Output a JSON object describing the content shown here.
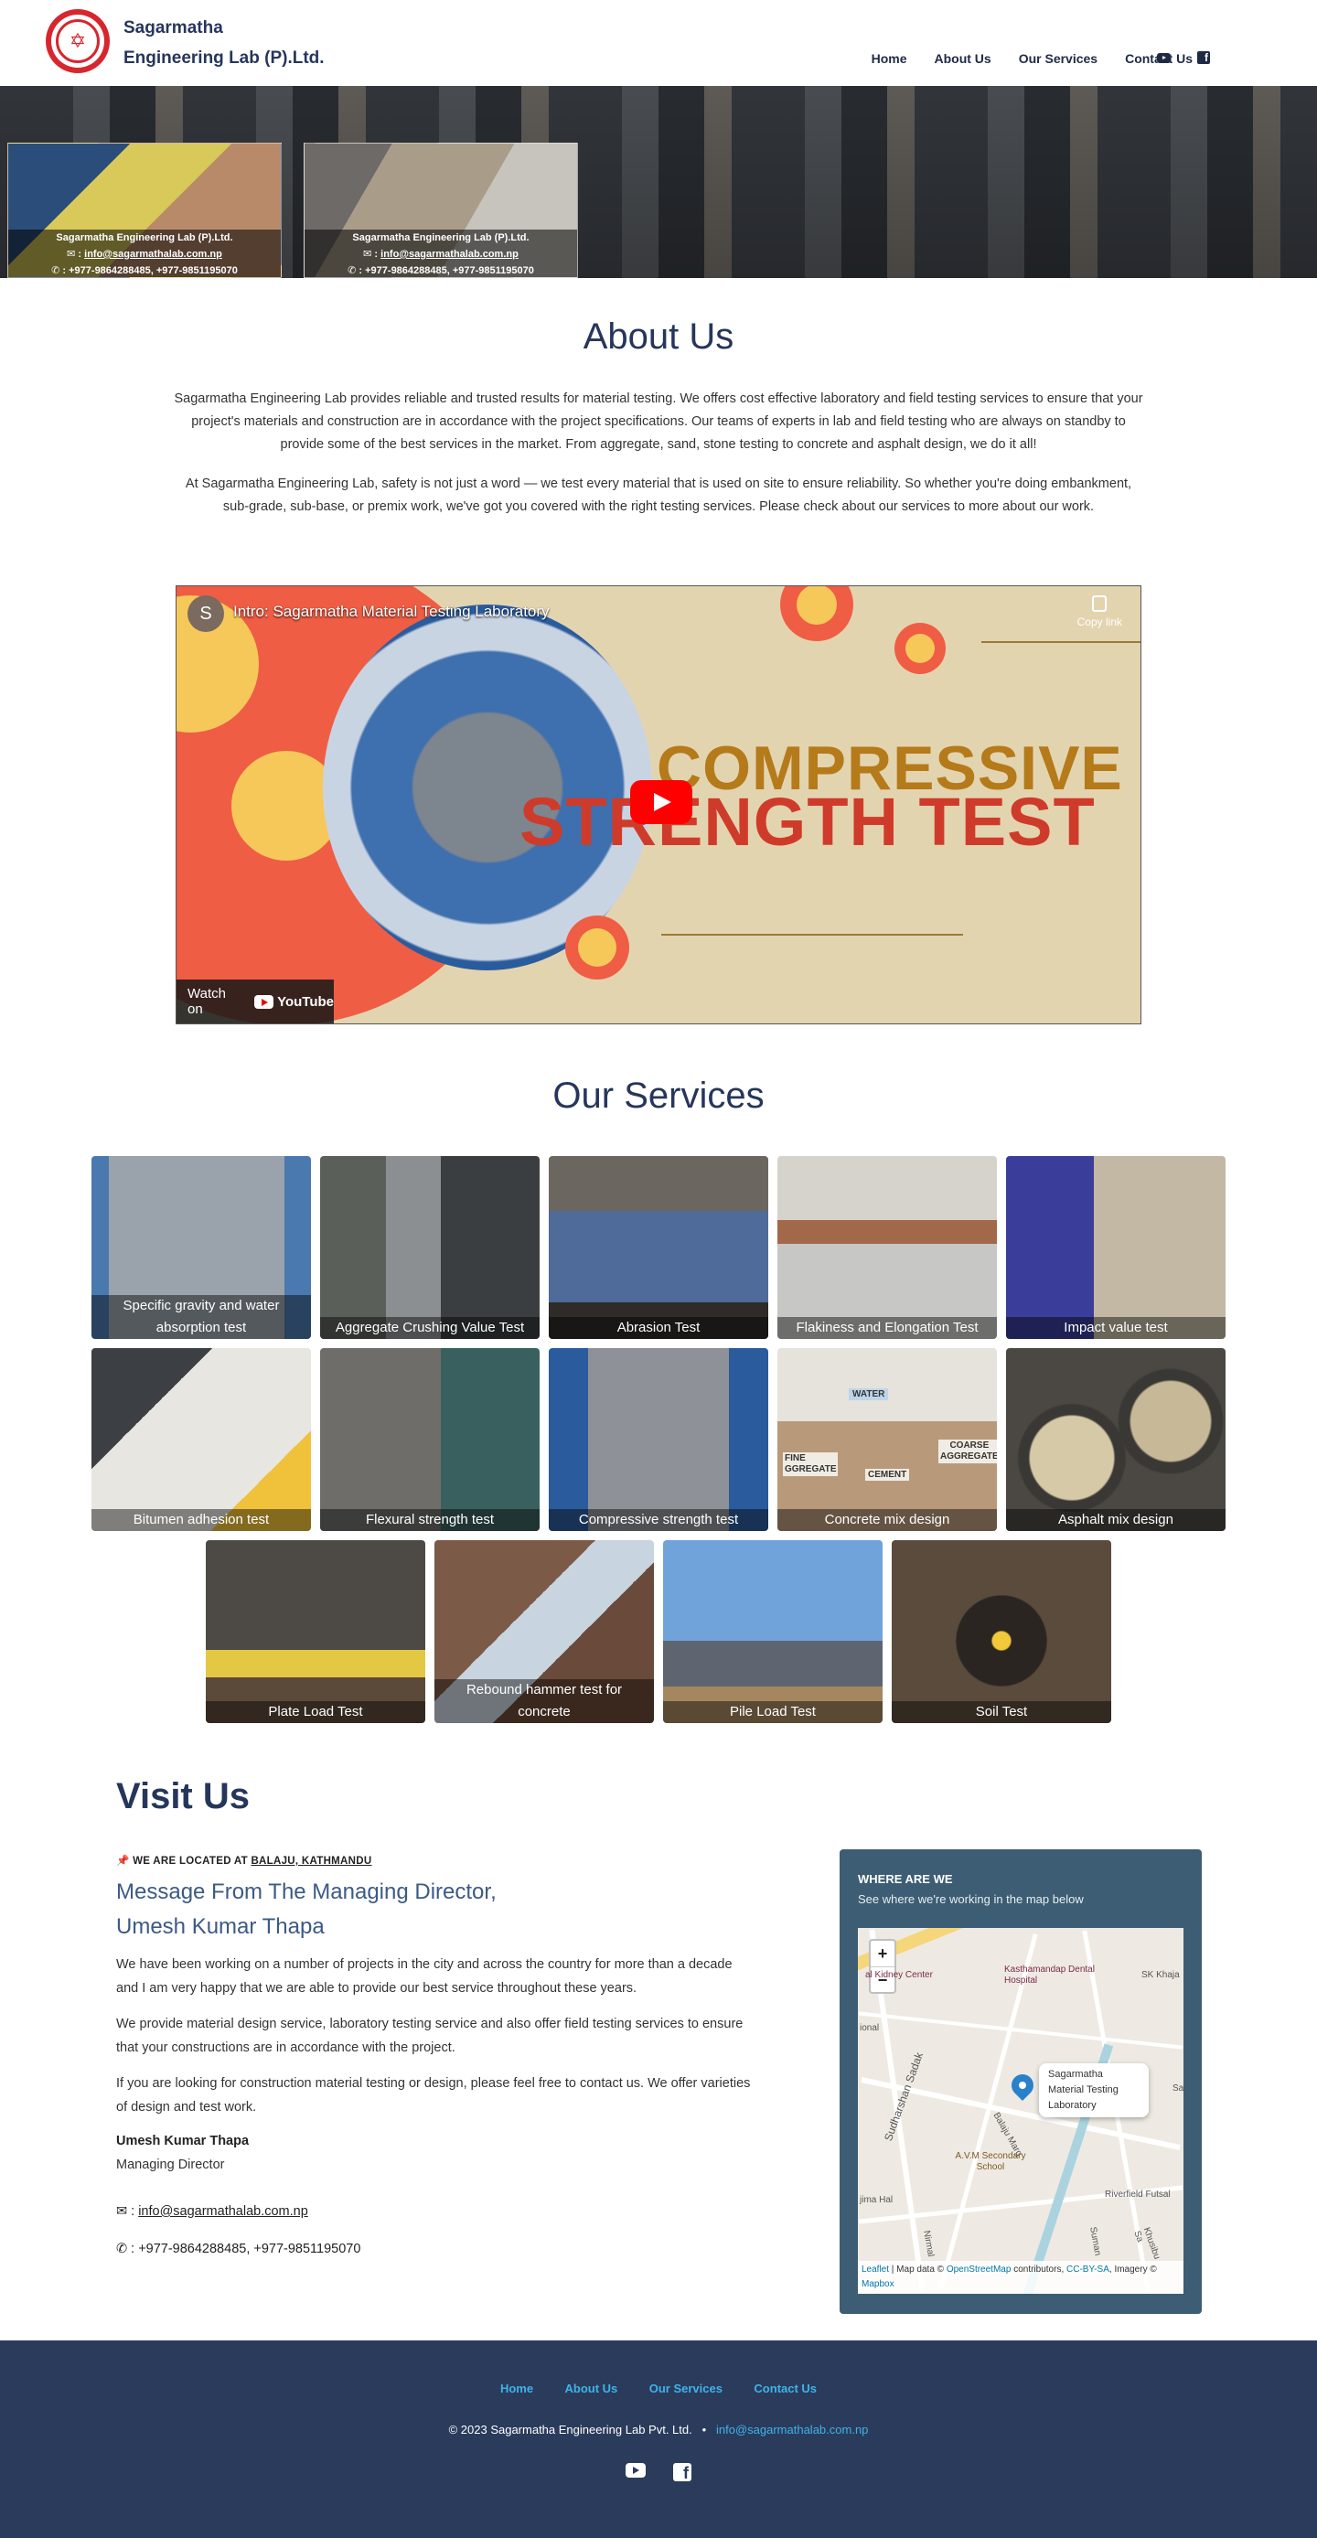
{
  "header": {
    "brand_line1": "Sagarmatha",
    "brand_line2": "Engineering Lab (P).Ltd.",
    "nav": [
      "Home",
      "About Us",
      "Our Services",
      "Contact Us"
    ]
  },
  "hero": {
    "cards": [
      {
        "company": "Sagarmatha Engineering Lab (P).Ltd.",
        "email": "info@sagarmathalab.com.np",
        "phone": ": +977-9864288485, +977-9851195070"
      },
      {
        "company": "Sagarmatha Engineering Lab (P).Ltd.",
        "email": "info@sagarmathalab.com.np",
        "phone": ": +977-9864288485, +977-9851195070"
      }
    ]
  },
  "about": {
    "title": "About Us",
    "p1": "Sagarmatha Engineering Lab provides reliable and trusted results for material testing. We offers cost effective laboratory and field testing services to ensure that your project's materials and construction are in accordance with the project specifications. Our teams of experts in lab and field testing who are always on standby to provide some of the best services in the market. From aggregate, sand, stone testing to concrete and asphalt design, we do it all!",
    "p2": "At Sagarmatha Engineering Lab, safety is not just a word — we test every material that is used on site to ensure reliability. So whether you're doing embankment, sub-grade, sub-base, or premix work, we've got you covered with the right testing services. Please check about our services to more about our work."
  },
  "video": {
    "avatar_letter": "S",
    "title": "Intro: Sagarmatha Material Testing Laboratory",
    "copy_label": "Copy link",
    "headline1": "COMPRESSIVE",
    "headline2": "STRENGTH TEST",
    "watch_label": "Watch on",
    "yt_label": "YouTube"
  },
  "services": {
    "title": "Our Services",
    "items": [
      "Specific gravity and water absorption test",
      "Aggregate Crushing Value Test",
      "Abrasion Test",
      "Flakiness and Elongation Test",
      "Impact value test",
      "Bitumen adhesion test",
      "Flexural strength test",
      "Compressive strength test",
      "Concrete mix design",
      "Asphalt mix design",
      "Plate Load Test",
      "Rebound hammer test for concrete",
      "Pile Load Test",
      "Soil Test"
    ],
    "mix_labels": {
      "water": "WATER",
      "fine1": "FINE",
      "fine2": "GGREGATE",
      "cement": "CEMENT",
      "coarse1": "COARSE",
      "coarse2": "AGGREGATE"
    }
  },
  "visit": {
    "title": "Visit Us",
    "located_prefix": "📌 WE ARE LOCATED AT ",
    "located_place": "BALAJU, KATHMANDU",
    "msg_line1": "Message From The Managing Director,",
    "msg_line2": "Umesh Kumar Thapa",
    "p1": "We have been working on a number of projects in the city and across the country for more than a decade and I am very happy that we are able to provide our best service throughout these years.",
    "p2": "We provide material design service, laboratory testing service and also offer field testing services to ensure that your constructions are in accordance with the project.",
    "p3": "If you are looking for construction material testing or design, please feel free to contact us. We offer varieties of design and test work.",
    "md_name": "Umesh Kumar Thapa",
    "md_role": "Managing Director",
    "email": "info@sagarmathalab.com.np",
    "phone": "+977-9864288485, +977-9851195070"
  },
  "where": {
    "heading": "WHERE ARE WE",
    "sub": "See where we're working in the map below",
    "popup": "Sagarmatha Material Testing Laboratory",
    "labels": [
      "al Kidney Center",
      "Kasthamandap Dental Hospital",
      "SK Khaja",
      "ional",
      "Sudharshan Sadak",
      "Balaju Marg",
      "A.V.M Secondary School",
      "Riverfield Futsal",
      "Nirmal",
      "jima Hal",
      "Khusibu Sa",
      "Suman",
      "Sa"
    ],
    "attribution_leaflet": "Leaflet",
    "attribution_mid": " | Map data © ",
    "attribution_osm": "OpenStreetMap",
    "attribution_contrib": " contributors, ",
    "attribution_cc": "CC-BY-SA",
    "attribution_imagery": ", Imagery © ",
    "attribution_mapbox": "Mapbox"
  },
  "footer": {
    "nav": [
      "Home",
      "About Us",
      "Our Services",
      "Contact Us"
    ],
    "copyright": "© 2023 Sagarmatha Engineering Lab Pvt. Ltd.",
    "bullet": "•",
    "email": "info@sagarmathalab.com.np"
  }
}
